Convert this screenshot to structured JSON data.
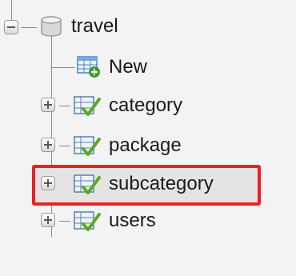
{
  "tree": {
    "database": {
      "name": "travel",
      "icon": "database-icon",
      "expanded": true
    },
    "new_item": {
      "label": "New",
      "icon": "new-table-icon"
    },
    "tables": [
      {
        "label": "category",
        "icon": "table-icon",
        "expanded": false,
        "highlighted": false
      },
      {
        "label": "package",
        "icon": "table-icon",
        "expanded": false,
        "highlighted": false
      },
      {
        "label": "subcategory",
        "icon": "table-icon",
        "expanded": false,
        "highlighted": true
      },
      {
        "label": "users",
        "icon": "table-icon",
        "expanded": false,
        "highlighted": false
      }
    ]
  },
  "colors": {
    "background": "#f3f3f3",
    "highlight_border": "#ec1f26",
    "highlight_fill": "#e4e4e4",
    "tree_line": "#8c8c8c"
  }
}
